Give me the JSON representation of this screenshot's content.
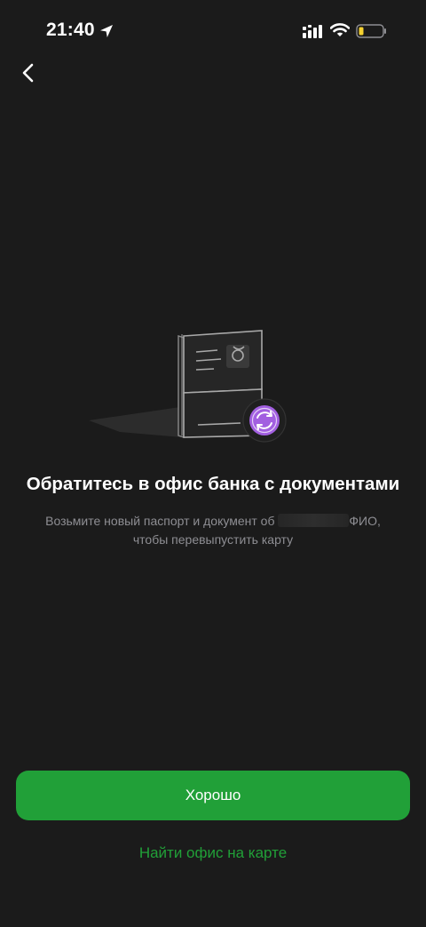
{
  "status_bar": {
    "time": "21:40",
    "icons": [
      "location-arrow-icon",
      "signal-icon",
      "wifi-icon",
      "battery-low-icon"
    ]
  },
  "nav": {
    "back_icon": "chevron-left-icon"
  },
  "illustration": {
    "icon": "passport-documents-refresh-icon",
    "accent_color": "#a25fe0"
  },
  "content": {
    "title": "Обратитесь в офис банка с документами",
    "subtitle_part1": "Возьмите новый паспорт и документ об",
    "subtitle_part2": "ФИО,",
    "subtitle_line2": "чтобы перевыпустить карту"
  },
  "actions": {
    "primary_label": "Хорошо",
    "link_label": "Найти офис на карте"
  },
  "colors": {
    "background": "#1b1b1b",
    "brand_green": "#21a038",
    "battery_yellow": "#f5d130",
    "secondary_text": "#8e8e93"
  }
}
